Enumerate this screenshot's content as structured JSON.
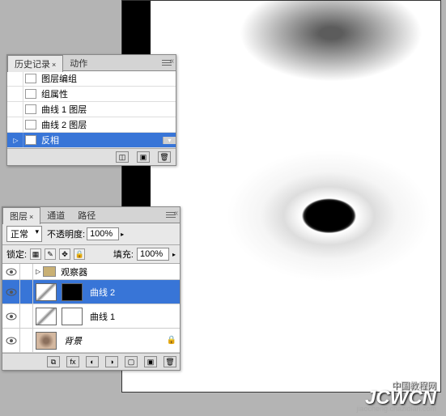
{
  "history_panel": {
    "tabs": [
      "历史记录",
      "动作"
    ],
    "active_tab": 0,
    "items": [
      {
        "label": "图层编组",
        "selected": false
      },
      {
        "label": "组属性",
        "selected": false
      },
      {
        "label": "曲线 1 图层",
        "selected": false
      },
      {
        "label": "曲线 2 图层",
        "selected": false
      },
      {
        "label": "反相",
        "selected": true
      }
    ]
  },
  "layers_panel": {
    "tabs": [
      "图层",
      "通道",
      "路径"
    ],
    "active_tab": 0,
    "blend_mode": "正常",
    "opacity_label": "不透明度:",
    "opacity_value": "100%",
    "lock_label": "锁定:",
    "fill_label": "填充:",
    "fill_value": "100%",
    "layers": [
      {
        "type": "group",
        "label": "观察器",
        "visible": true
      },
      {
        "type": "adjustment",
        "label": "曲线 2",
        "mask": "black",
        "visible": true,
        "selected": true
      },
      {
        "type": "adjustment",
        "label": "曲线 1",
        "mask": "white",
        "visible": true,
        "selected": false
      },
      {
        "type": "background",
        "label": "背景",
        "visible": true,
        "locked": true
      }
    ]
  },
  "watermark": {
    "main": "JCWCN",
    "top": "中国教程网",
    "sub": "jiaocheng.chazidian.com"
  }
}
